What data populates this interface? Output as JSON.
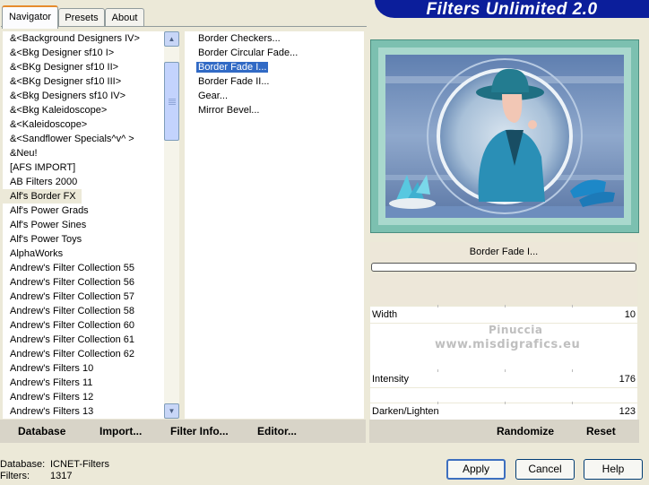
{
  "window": {
    "title": "Filters Unlimited 2.0"
  },
  "tabs": [
    {
      "label": "Navigator"
    },
    {
      "label": "Presets"
    },
    {
      "label": "About"
    }
  ],
  "categories": {
    "items": [
      "&<Background Designers IV>",
      "&<Bkg Designer sf10 I>",
      "&<BKg Designer sf10 II>",
      "&<BKg Designer sf10 III>",
      "&<Bkg Designers sf10 IV>",
      "&<Bkg Kaleidoscope>",
      "&<Kaleidoscope>",
      "&<Sandflower Specials^v^ >",
      "&Neu!",
      "[AFS IMPORT]",
      "AB Filters 2000",
      "Alf's Border FX",
      "Alf's Power Grads",
      "Alf's Power Sines",
      "Alf's Power Toys",
      "AlphaWorks",
      "Andrew's Filter Collection 55",
      "Andrew's Filter Collection 56",
      "Andrew's Filter Collection 57",
      "Andrew's Filter Collection 58",
      "Andrew's Filter Collection 60",
      "Andrew's Filter Collection 61",
      "Andrew's Filter Collection 62",
      "Andrew's Filters 10",
      "Andrew's Filters 11",
      "Andrew's Filters 12",
      "Andrew's Filters 13"
    ],
    "selected": "Alf's Border FX"
  },
  "filters": {
    "items": [
      "Border Checkers...",
      "Border Circular Fade...",
      "Border Fade I...",
      "Border Fade II...",
      "Gear...",
      "Mirror Bevel..."
    ],
    "selected": "Border Fade I..."
  },
  "toolbar_left": {
    "database": "Database",
    "import": "Import...",
    "filter_info": "Filter Info...",
    "editor": "Editor..."
  },
  "toolbar_right": {
    "randomize": "Randomize",
    "reset": "Reset"
  },
  "preview": {
    "filter_name": "Border Fade I...",
    "progress": 0
  },
  "sliders": [
    {
      "label": "Width",
      "value": "10"
    },
    {
      "label": "Intensity",
      "value": "176"
    },
    {
      "label": "Darken/Lighten",
      "value": "123"
    }
  ],
  "watermark": {
    "line1": "Pinuccia",
    "line2": "www.misdigrafics.eu"
  },
  "footer": {
    "database_label": "Database:",
    "database_value": "ICNET-Filters",
    "filters_label": "Filters:",
    "filters_value": "1317"
  },
  "buttons": {
    "apply": "Apply",
    "cancel": "Cancel",
    "help": "Help"
  },
  "colors": {
    "title_banner": "#0b1e9b",
    "selection": "#316ac5",
    "preview_border": "#6fb8a8"
  }
}
